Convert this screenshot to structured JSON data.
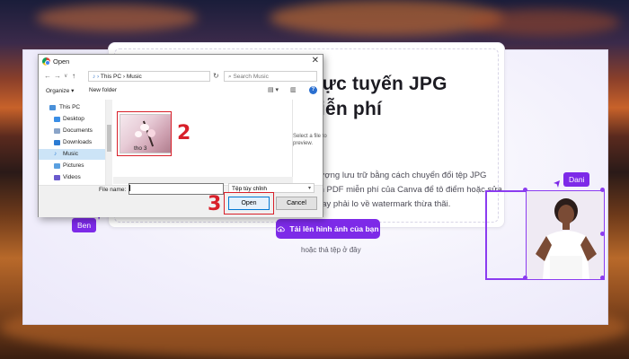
{
  "dialog": {
    "title": "Open",
    "address": "This PC  ›  Music",
    "search_placeholder": "Search Music",
    "toolbar": {
      "organize": "Organize ▾",
      "new_folder": "New folder"
    },
    "nav_items": [
      "This PC",
      "Desktop",
      "Documents",
      "Downloads",
      "Music",
      "Pictures",
      "Videos"
    ],
    "selected_nav": "Music",
    "file_name": "tho 3",
    "preview_hint": "Select a file to preview.",
    "file_name_label": "File name:",
    "file_name_value": "",
    "file_type": "Tệp tùy chỉnh",
    "open_label": "Open",
    "cancel_label": "Cancel"
  },
  "annotations": {
    "step2": "2",
    "step3": "3"
  },
  "page": {
    "title_line1": "ổi trực tuyến JPG",
    "title_line2": "F miễn phí",
    "desc_line1": "g lượng lưu trữ bằng cách chuyển đổi tệp JPG",
    "desc_line2": "ành PDF miễn phí của Canva để tô điểm hoặc sửa",
    "desc_line3": "g hay phải lo về watermark thừa thãi.",
    "upload_button": "Tải lên hình ảnh của bạn",
    "drop_text": "hoặc thả tệp ở đây",
    "ben_tag": "Ben",
    "dani_tag": "Dani"
  },
  "colors": {
    "accent": "#7d2ae8",
    "annotation_red": "#d8202a",
    "selection": "#cce4f7"
  }
}
